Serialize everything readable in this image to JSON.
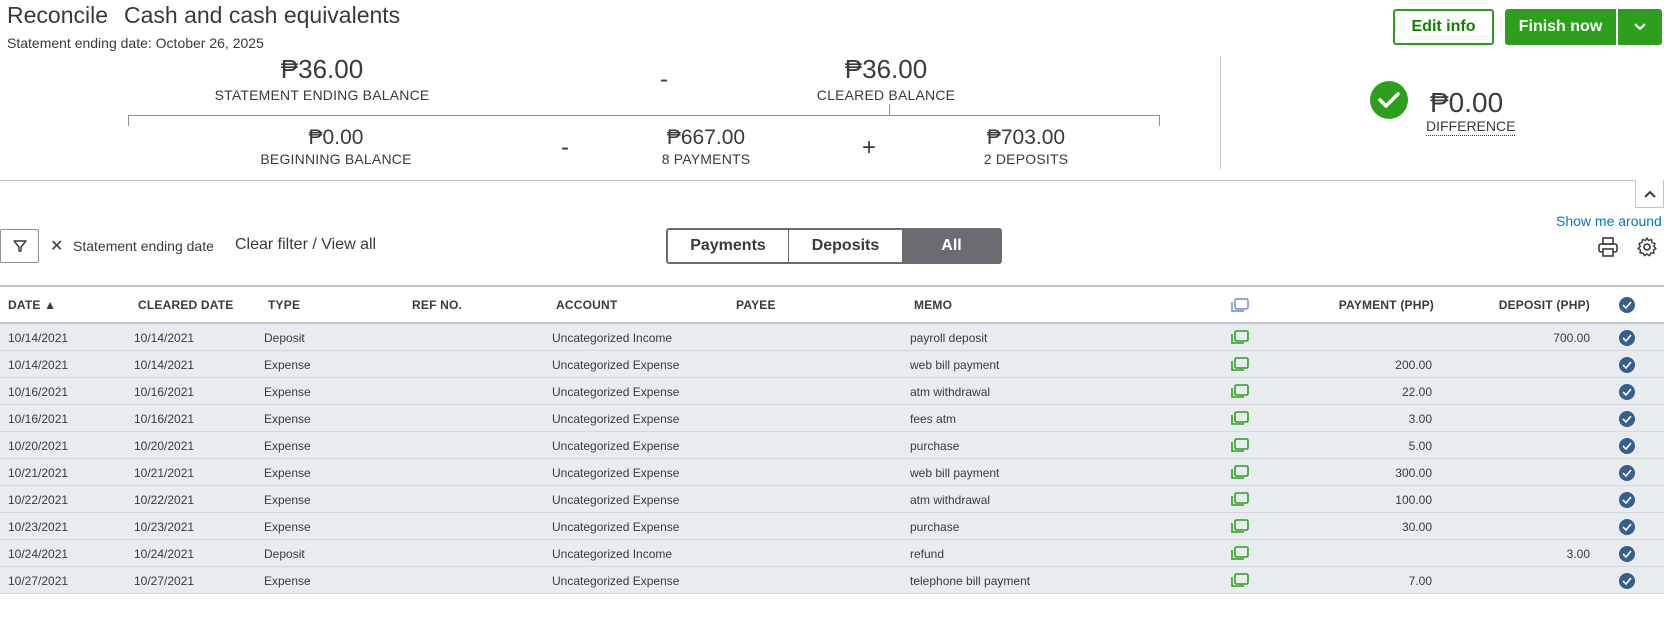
{
  "header": {
    "title": "Reconcile",
    "account": "Cash and cash equivalents",
    "statement_date": "Statement ending date: October 26, 2025",
    "edit_info": "Edit info",
    "finish_now": "Finish now"
  },
  "summary": {
    "statement_ending_balance": "₱36.00",
    "statement_ending_label": "STATEMENT ENDING BALANCE",
    "minus1": "-",
    "cleared_balance": "₱36.00",
    "cleared_label": "CLEARED BALANCE",
    "beginning_balance": "₱0.00",
    "beginning_label": "BEGINNING BALANCE",
    "minus2": "-",
    "payments_amount": "₱667.00",
    "payments_label": "8 PAYMENTS",
    "plus": "+",
    "deposits_amount": "₱703.00",
    "deposits_label": "2 DEPOSITS",
    "difference": "₱0.00",
    "difference_label": "DIFFERENCE"
  },
  "toolbar": {
    "show_me_around": "Show me around",
    "filter_x": "✕",
    "filter_chip": "Statement ending date",
    "clear_filter": "Clear filter / View all",
    "tabs": [
      "Payments",
      "Deposits",
      "All"
    ],
    "active_tab": "All"
  },
  "table": {
    "columns": {
      "date": "DATE ▲",
      "cleared_date": "CLEARED DATE",
      "type": "TYPE",
      "ref_no": "REF NO.",
      "account": "ACCOUNT",
      "payee": "PAYEE",
      "memo": "MEMO",
      "payment": "PAYMENT (PHP)",
      "deposit": "DEPOSIT (PHP)"
    },
    "rows": [
      {
        "date": "10/14/2021",
        "cleared": "10/14/2021",
        "type": "Deposit",
        "account": "Uncategorized Income",
        "memo": "payroll deposit",
        "payment": "",
        "deposit": "700.00"
      },
      {
        "date": "10/14/2021",
        "cleared": "10/14/2021",
        "type": "Expense",
        "account": "Uncategorized Expense",
        "memo": "web bill payment",
        "payment": "200.00",
        "deposit": ""
      },
      {
        "date": "10/16/2021",
        "cleared": "10/16/2021",
        "type": "Expense",
        "account": "Uncategorized Expense",
        "memo": "atm withdrawal",
        "payment": "22.00",
        "deposit": ""
      },
      {
        "date": "10/16/2021",
        "cleared": "10/16/2021",
        "type": "Expense",
        "account": "Uncategorized Expense",
        "memo": "fees atm",
        "payment": "3.00",
        "deposit": ""
      },
      {
        "date": "10/20/2021",
        "cleared": "10/20/2021",
        "type": "Expense",
        "account": "Uncategorized Expense",
        "memo": "purchase",
        "payment": "5.00",
        "deposit": ""
      },
      {
        "date": "10/21/2021",
        "cleared": "10/21/2021",
        "type": "Expense",
        "account": "Uncategorized Expense",
        "memo": "web bill payment",
        "payment": "300.00",
        "deposit": ""
      },
      {
        "date": "10/22/2021",
        "cleared": "10/22/2021",
        "type": "Expense",
        "account": "Uncategorized Expense",
        "memo": "atm withdrawal",
        "payment": "100.00",
        "deposit": ""
      },
      {
        "date": "10/23/2021",
        "cleared": "10/23/2021",
        "type": "Expense",
        "account": "Uncategorized Expense",
        "memo": "purchase",
        "payment": "30.00",
        "deposit": ""
      },
      {
        "date": "10/24/2021",
        "cleared": "10/24/2021",
        "type": "Deposit",
        "account": "Uncategorized Income",
        "memo": "refund",
        "payment": "",
        "deposit": "3.00"
      },
      {
        "date": "10/27/2021",
        "cleared": "10/27/2021",
        "type": "Expense",
        "account": "Uncategorized Expense",
        "memo": "telephone bill payment",
        "payment": "7.00",
        "deposit": ""
      }
    ]
  },
  "icons": {
    "filter": "filter-icon",
    "close": "close-icon",
    "collapse": "chevron-up-icon",
    "print": "print-icon",
    "settings": "gear-icon",
    "copy": "copy-icon",
    "cleared": "check-circle-icon",
    "success": "check-circle-icon"
  },
  "colors": {
    "brand_green": "#2ca01c",
    "link_blue": "#0077c5",
    "row_bg": "#e9ecef",
    "cleared_blue": "#365f8d"
  }
}
